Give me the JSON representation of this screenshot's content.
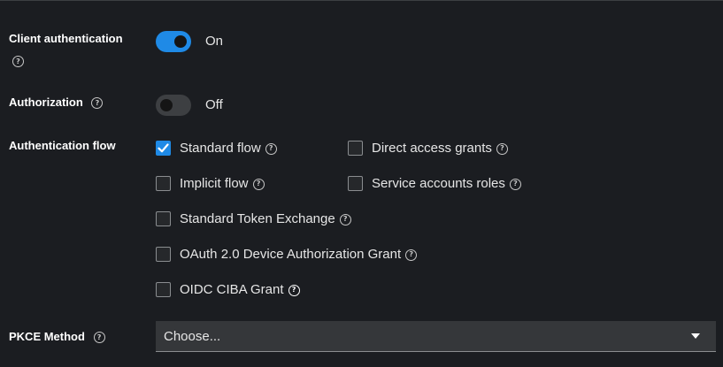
{
  "client_authentication": {
    "label": "Client authentication",
    "state": "On",
    "enabled": true
  },
  "authorization": {
    "label": "Authorization",
    "state": "Off",
    "enabled": false
  },
  "authentication_flow": {
    "label": "Authentication flow",
    "options": [
      {
        "label": "Standard flow",
        "checked": true
      },
      {
        "label": "Direct access grants",
        "checked": false
      },
      {
        "label": "Implicit flow",
        "checked": false
      },
      {
        "label": "Service accounts roles",
        "checked": false
      },
      {
        "label": "Standard Token Exchange",
        "checked": false
      },
      {
        "label": "OAuth 2.0 Device Authorization Grant",
        "checked": false
      },
      {
        "label": "OIDC CIBA Grant",
        "checked": false
      }
    ]
  },
  "pkce_method": {
    "label": "PKCE Method",
    "placeholder": "Choose..."
  },
  "help_icon_glyph": "?",
  "colors": {
    "accent": "#1f8ae6",
    "background": "#1b1d21",
    "select_background": "#35373a"
  }
}
